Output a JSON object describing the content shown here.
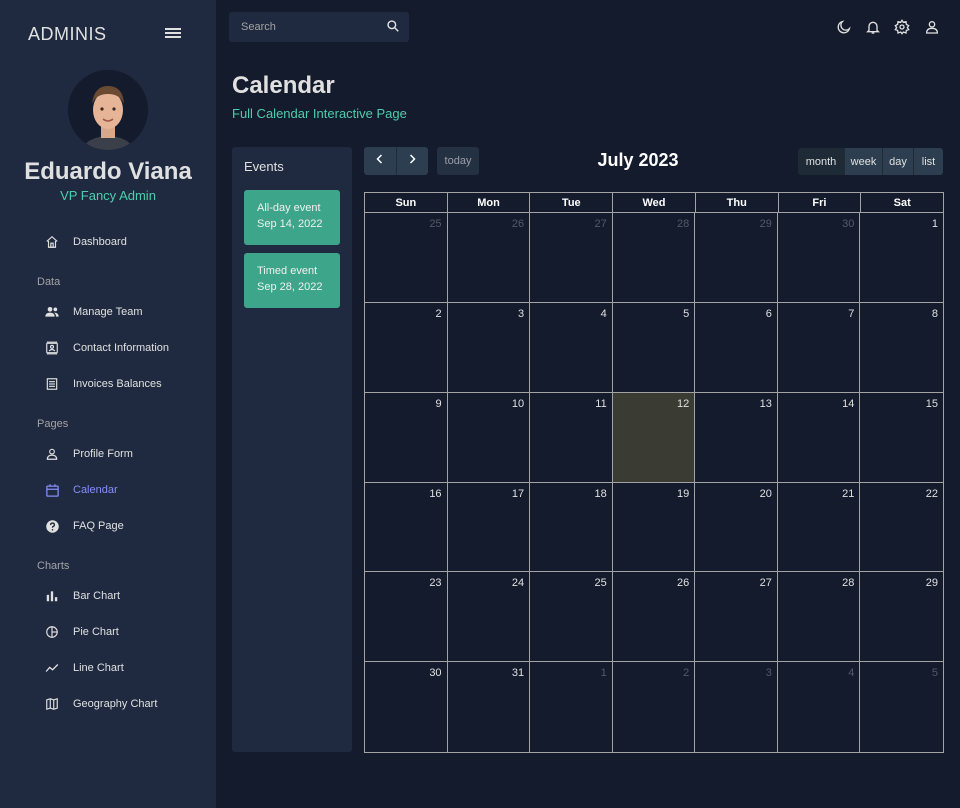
{
  "sidebar": {
    "brand": "ADMINIS",
    "user": {
      "name": "Eduardo Viana",
      "role": "VP Fancy Admin"
    },
    "items": [
      {
        "label": "Dashboard",
        "icon": "home-icon"
      },
      {
        "section": "Data"
      },
      {
        "label": "Manage Team",
        "icon": "people-icon"
      },
      {
        "label": "Contact Information",
        "icon": "contacts-icon"
      },
      {
        "label": "Invoices Balances",
        "icon": "receipt-icon"
      },
      {
        "section": "Pages"
      },
      {
        "label": "Profile Form",
        "icon": "person-icon"
      },
      {
        "label": "Calendar",
        "icon": "calendar-icon",
        "active": true
      },
      {
        "label": "FAQ Page",
        "icon": "help-icon"
      },
      {
        "section": "Charts"
      },
      {
        "label": "Bar Chart",
        "icon": "bar-chart-icon"
      },
      {
        "label": "Pie Chart",
        "icon": "pie-chart-icon"
      },
      {
        "label": "Line Chart",
        "icon": "line-chart-icon"
      },
      {
        "label": "Geography Chart",
        "icon": "map-icon"
      }
    ]
  },
  "topbar": {
    "search_placeholder": "Search",
    "icons": [
      "dark-mode-icon",
      "notifications-icon",
      "settings-icon",
      "user-icon"
    ]
  },
  "header": {
    "title": "Calendar",
    "subtitle": "Full Calendar Interactive Page"
  },
  "events": {
    "title": "Events",
    "items": [
      {
        "title": "All-day event",
        "date": "Sep 14, 2022"
      },
      {
        "title": "Timed event",
        "date": "Sep 28, 2022"
      }
    ]
  },
  "calendar": {
    "title": "July 2023",
    "today_label": "today",
    "views": [
      "month",
      "week",
      "day",
      "list"
    ],
    "active_view": "month",
    "weekdays": [
      "Sun",
      "Mon",
      "Tue",
      "Wed",
      "Thu",
      "Fri",
      "Sat"
    ],
    "today": 12,
    "days": [
      {
        "d": "25",
        "other": true
      },
      {
        "d": "26",
        "other": true
      },
      {
        "d": "27",
        "other": true
      },
      {
        "d": "28",
        "other": true
      },
      {
        "d": "29",
        "other": true
      },
      {
        "d": "30",
        "other": true
      },
      {
        "d": "1"
      },
      {
        "d": "2"
      },
      {
        "d": "3"
      },
      {
        "d": "4"
      },
      {
        "d": "5"
      },
      {
        "d": "6"
      },
      {
        "d": "7"
      },
      {
        "d": "8"
      },
      {
        "d": "9"
      },
      {
        "d": "10"
      },
      {
        "d": "11"
      },
      {
        "d": "12"
      },
      {
        "d": "13"
      },
      {
        "d": "14"
      },
      {
        "d": "15"
      },
      {
        "d": "16"
      },
      {
        "d": "17"
      },
      {
        "d": "18"
      },
      {
        "d": "19"
      },
      {
        "d": "20"
      },
      {
        "d": "21"
      },
      {
        "d": "22"
      },
      {
        "d": "23"
      },
      {
        "d": "24"
      },
      {
        "d": "25"
      },
      {
        "d": "26"
      },
      {
        "d": "27"
      },
      {
        "d": "28"
      },
      {
        "d": "29"
      },
      {
        "d": "30"
      },
      {
        "d": "31"
      },
      {
        "d": "1",
        "other": true
      },
      {
        "d": "2",
        "other": true
      },
      {
        "d": "3",
        "other": true
      },
      {
        "d": "4",
        "other": true
      },
      {
        "d": "5",
        "other": true
      }
    ]
  },
  "colors": {
    "background": "#141b2d",
    "panel": "#1f2a40",
    "accent_green": "#4cceac",
    "event_green": "#3da58a",
    "active_nav": "#868dfb",
    "today_cell": "#3a3c33"
  }
}
